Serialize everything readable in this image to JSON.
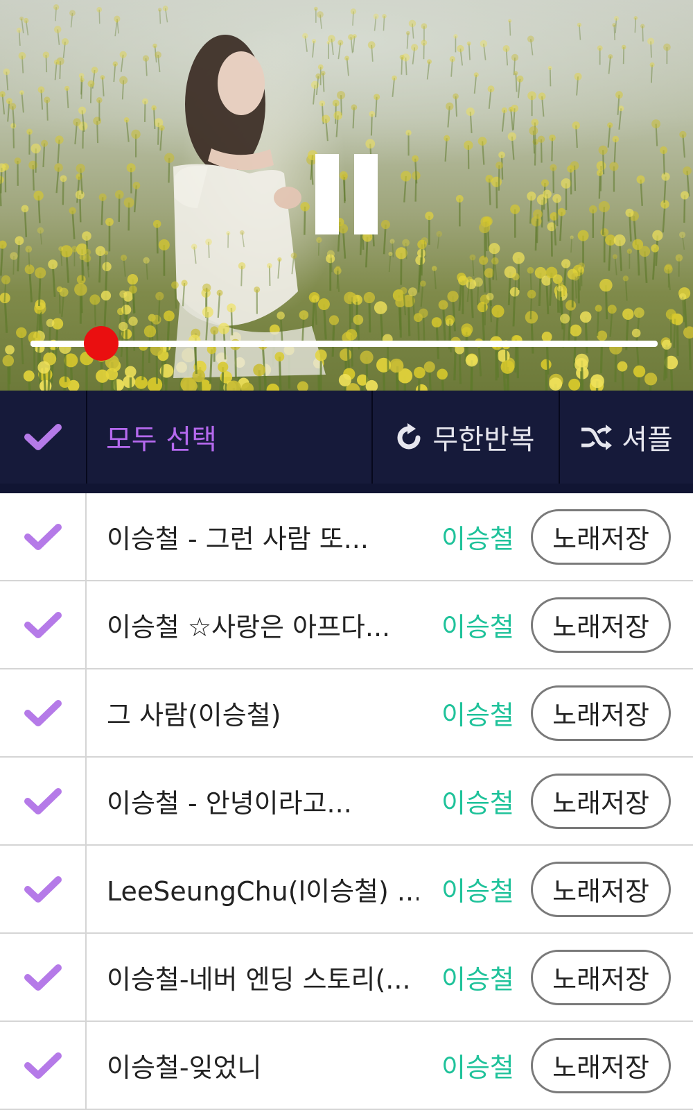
{
  "player": {
    "state": "playing",
    "pause_icon": "pause-icon",
    "progress": 0.113,
    "seek_colors": {
      "track": "#ffffff",
      "thumb": "#ea0f10"
    }
  },
  "toolbar": {
    "select_all_icon": "check-icon",
    "select_all_label": "모두 선택",
    "repeat_icon": "repeat-icon",
    "repeat_label": "무한반복",
    "shuffle_icon": "shuffle-icon",
    "shuffle_label": "셔플",
    "colors": {
      "background": "#161a3a",
      "accent": "#b569ee",
      "check": "#b57ae8"
    }
  },
  "songs": [
    {
      "title": "이승철 - 그런 사람 또...",
      "artist": "이승철",
      "save_label": "노래저장",
      "checked": true
    },
    {
      "title": "이승철 ☆사랑은 아프다...",
      "artist": "이승철",
      "save_label": "노래저장",
      "checked": true
    },
    {
      "title": "그 사람(이승철)",
      "artist": "이승철",
      "save_label": "노래저장",
      "checked": true
    },
    {
      "title": "이승철 - 안녕이라고...",
      "artist": "이승철",
      "save_label": "노래저장",
      "checked": true
    },
    {
      "title": "LeeSeungChu(l이승철) ...",
      "artist": "이승철",
      "save_label": "노래저장",
      "checked": true
    },
    {
      "title": "이승철-네버 엔딩 스토리(...",
      "artist": "이승철",
      "save_label": "노래저장",
      "checked": true
    },
    {
      "title": "이승철-잊었니",
      "artist": "이승철",
      "save_label": "노래저장",
      "checked": true
    }
  ],
  "list_colors": {
    "artist": "#1fc29a",
    "check": "#b57ae8"
  }
}
